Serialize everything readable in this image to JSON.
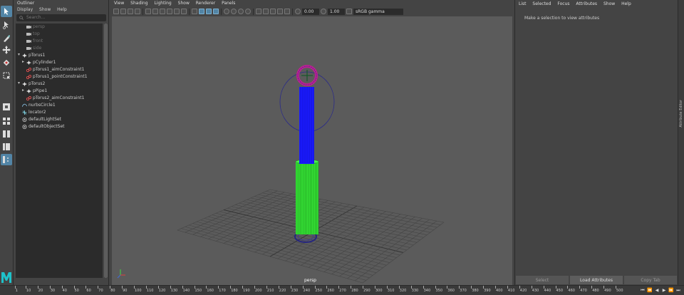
{
  "outliner": {
    "title": "Outliner",
    "menu": [
      "Display",
      "Show",
      "Help"
    ],
    "search_placeholder": "Search...",
    "items": [
      {
        "label": "persp",
        "depth": 1,
        "icon": "camera-icon",
        "dim": true,
        "twisty": ""
      },
      {
        "label": "top",
        "depth": 1,
        "icon": "camera-icon",
        "dim": true,
        "twisty": ""
      },
      {
        "label": "front",
        "depth": 1,
        "icon": "camera-icon",
        "dim": true,
        "twisty": ""
      },
      {
        "label": "side",
        "depth": 1,
        "icon": "camera-icon",
        "dim": true,
        "twisty": ""
      },
      {
        "label": "pTorus1",
        "depth": 0,
        "icon": "transform-icon",
        "dim": false,
        "twisty": "▾"
      },
      {
        "label": "pCylinder1",
        "depth": 1,
        "icon": "transform-icon",
        "dim": false,
        "twisty": "▸"
      },
      {
        "label": "pTorus1_aimConstraint1",
        "depth": 1,
        "icon": "constraint-icon",
        "dim": false,
        "twisty": ""
      },
      {
        "label": "pTorus1_pointConstraint1",
        "depth": 1,
        "icon": "constraint-icon",
        "dim": false,
        "twisty": ""
      },
      {
        "label": "pTorus2",
        "depth": 0,
        "icon": "transform-icon",
        "dim": false,
        "twisty": "▾"
      },
      {
        "label": "pPipe1",
        "depth": 1,
        "icon": "transform-icon",
        "dim": false,
        "twisty": "▸"
      },
      {
        "label": "pTorus2_aimConstraint1",
        "depth": 1,
        "icon": "constraint-icon",
        "dim": false,
        "twisty": ""
      },
      {
        "label": "nurbsCircle1",
        "depth": 0,
        "icon": "curve-icon",
        "dim": false,
        "twisty": ""
      },
      {
        "label": "locator2",
        "depth": 0,
        "icon": "locator-icon",
        "dim": false,
        "twisty": ""
      },
      {
        "label": "defaultLightSet",
        "depth": 0,
        "icon": "set-icon",
        "dim": false,
        "twisty": ""
      },
      {
        "label": "defaultObjectSet",
        "depth": 0,
        "icon": "set-icon",
        "dim": false,
        "twisty": ""
      }
    ]
  },
  "viewport": {
    "menu": [
      "View",
      "Shading",
      "Lighting",
      "Show",
      "Renderer",
      "Panels"
    ],
    "exposure": "0.00",
    "gamma": "1.00",
    "colorspace": "sRGB gamma",
    "camera_label": "persp"
  },
  "attribute_editor": {
    "menu": [
      "List",
      "Selected",
      "Focus",
      "Attributes",
      "Show",
      "Help"
    ],
    "message": "Make a selection to view attributes",
    "buttons": [
      "Select",
      "Load Attributes",
      "Copy Tab"
    ],
    "side_tab": "Attribute Editor"
  },
  "timeline": {
    "ticks": [
      "1",
      "10",
      "20",
      "30",
      "40",
      "50",
      "60",
      "70",
      "80",
      "90",
      "100",
      "110",
      "120",
      "130",
      "140",
      "150",
      "160",
      "170",
      "180",
      "190",
      "200",
      "210",
      "220",
      "230",
      "240",
      "250",
      "260",
      "270",
      "280",
      "290",
      "300",
      "310",
      "320",
      "330",
      "340",
      "350",
      "360",
      "370",
      "380",
      "390",
      "400",
      "410",
      "420",
      "430",
      "440",
      "450",
      "460",
      "470",
      "480",
      "490",
      "500"
    ]
  },
  "colors": {
    "accent": "#5285a6",
    "cylinder_blue": "#1a1aff",
    "pipe_green": "#35e035",
    "torus_magenta": "#c0208f"
  }
}
